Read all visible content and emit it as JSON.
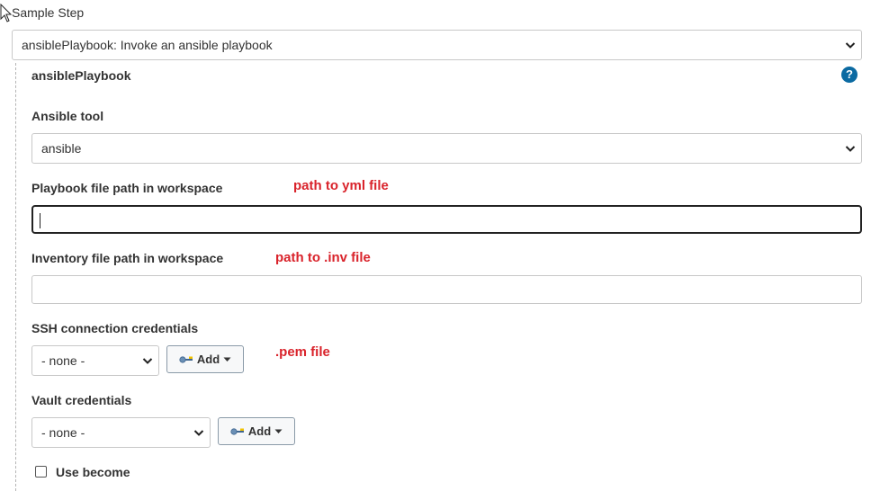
{
  "step": {
    "label": "Sample Step",
    "selected": "ansiblePlaybook: Invoke an ansible playbook"
  },
  "section": {
    "title": "ansiblePlaybook",
    "help": "?"
  },
  "ansible_tool": {
    "label": "Ansible tool",
    "selected": "ansible"
  },
  "playbook": {
    "label": "Playbook file path in workspace",
    "value": "",
    "annotation": "path to yml file"
  },
  "inventory": {
    "label": "Inventory file path in workspace",
    "value": "",
    "annotation": "path to .inv file"
  },
  "ssh": {
    "label": "SSH connection credentials",
    "selected": "- none -",
    "add_label": "Add",
    "annotation": ".pem file"
  },
  "vault": {
    "label": "Vault credentials",
    "selected": "- none -",
    "add_label": "Add"
  },
  "become": {
    "label": "Use become",
    "checked": false
  },
  "colors": {
    "annotation": "#d9232b",
    "help_icon": "#0b6aa2"
  }
}
